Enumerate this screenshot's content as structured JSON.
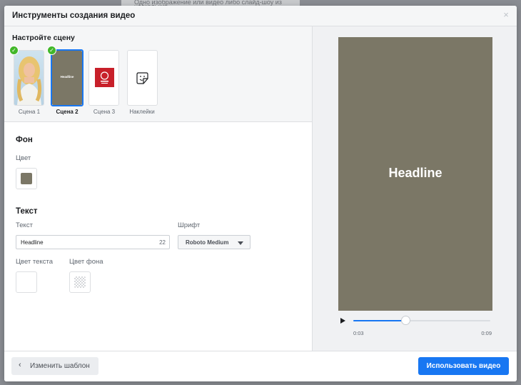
{
  "background_hint": "Одно изображение или видео либо слайд-шоу из нескольких",
  "dialog": {
    "title": "Инструменты создания видео",
    "close_glyph": "×"
  },
  "scenes": {
    "title": "Настройте сцену",
    "items": [
      {
        "label": "Сцена 1",
        "done": true,
        "selected": false
      },
      {
        "label": "Сцена 2",
        "done": true,
        "selected": true,
        "thumb_text": "Headline"
      },
      {
        "label": "Сцена 3",
        "done": false,
        "selected": false
      },
      {
        "label": "Наклейки",
        "icon": "sticker-icon"
      }
    ]
  },
  "background_section": {
    "title": "Фон",
    "color_label": "Цвет",
    "color": "#7b7766"
  },
  "text_section": {
    "title": "Текст",
    "text_label": "Текст",
    "text_value": "Headline",
    "char_count": "22",
    "font_label": "Шрифт",
    "font_value": "Roboto Medium",
    "text_color_label": "Цвет текста",
    "bg_color_label": "Цвет фона"
  },
  "preview": {
    "headline": "Headline",
    "progress": 0.38,
    "time_current": "0:03",
    "time_total": "0:09",
    "accent": "#1877f2"
  },
  "footer": {
    "back_label": "Изменить шаблон",
    "primary_label": "Использовать видео"
  }
}
